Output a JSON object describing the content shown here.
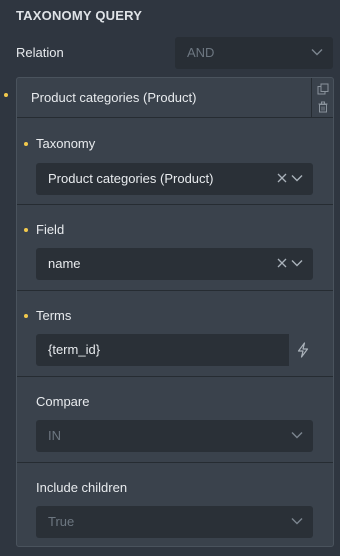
{
  "section": {
    "title": "TAXONOMY QUERY"
  },
  "relation": {
    "label": "Relation",
    "value": "AND"
  },
  "group": {
    "title": "Product categories (Product)",
    "fields": {
      "taxonomy": {
        "label": "Taxonomy",
        "value": "Product categories (Product)"
      },
      "field": {
        "label": "Field",
        "value": "name"
      },
      "terms": {
        "label": "Terms",
        "value": "{term_id}"
      },
      "compare": {
        "label": "Compare",
        "value": "IN"
      },
      "include_children": {
        "label": "Include children",
        "value": "True"
      }
    }
  },
  "colors": {
    "accent_dot": "#f2c94c",
    "panel_bg": "#2f3640",
    "group_bg": "#3a424c",
    "input_bg": "#282e35"
  },
  "icons": [
    "chevron-down-icon",
    "clear-icon",
    "duplicate-icon",
    "trash-icon",
    "dynamic-data-icon"
  ]
}
